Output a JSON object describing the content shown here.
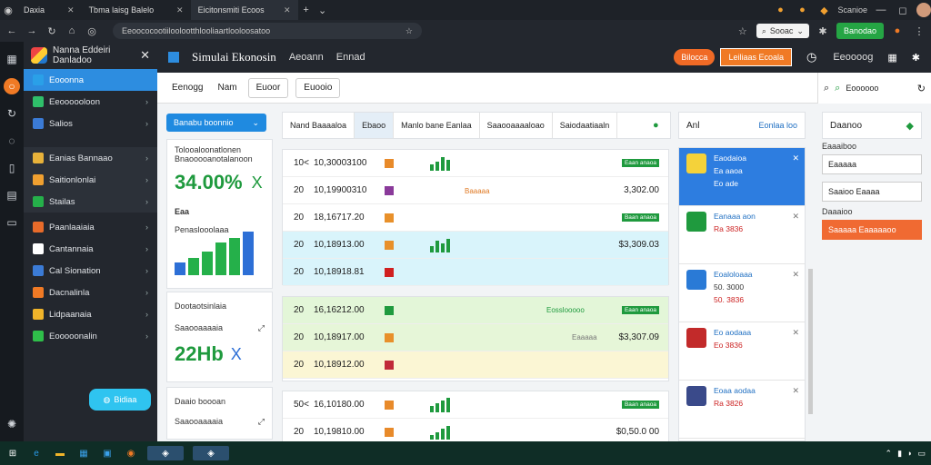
{
  "browser": {
    "tabs": [
      {
        "label": "Daxia",
        "active": false
      },
      {
        "label": "Tbma laisg Balelo",
        "active": false
      },
      {
        "label": "Eicitonsmiti Ecoos",
        "active": true
      }
    ],
    "url": "Eeoococootiiloolootthlooliaartlooloosatoo",
    "search_label": "Sooac",
    "ext_label": "Scanioe",
    "go_button": "Banodao"
  },
  "sidebar": {
    "title_line1": "Nanna Eddeiri",
    "title_line2": "Danladoo",
    "items": [
      {
        "label": "Eooonna",
        "icon": "#2aa0e8",
        "active": true,
        "sub": false
      },
      {
        "label": "Eeoooooloon",
        "icon": "#2fbf6a",
        "active": false,
        "sub": false
      },
      {
        "label": "Salios",
        "icon": "#3b7bd6",
        "active": false,
        "sub": false
      },
      {
        "label": "Eanias Bannaao",
        "icon": "#e8b23a",
        "active": false,
        "sub": true
      },
      {
        "label": "Saitionlonlai",
        "icon": "#f0a030",
        "active": false,
        "sub": true
      },
      {
        "label": "Stailas",
        "icon": "#25b04a",
        "active": false,
        "sub": true
      },
      {
        "label": "Paanlaaiaia",
        "icon": "#e86b2a",
        "active": false,
        "sub": false
      },
      {
        "label": "Cantannaia",
        "icon": "#ffffff",
        "active": false,
        "sub": false
      },
      {
        "label": "Cal Sionation",
        "icon": "#3b7bd6",
        "active": false,
        "sub": false
      },
      {
        "label": "Dacnalinla",
        "icon": "#f07a25",
        "active": false,
        "sub": false
      },
      {
        "label": "Lidpaanaia",
        "icon": "#f0b42a",
        "active": false,
        "sub": false
      },
      {
        "label": "Eooooonalin",
        "icon": "#2fbf4a",
        "active": false,
        "sub": false
      }
    ],
    "pill_label": "Bidiaa"
  },
  "header": {
    "title": "Simulai Ekonosin",
    "link1": "Aeoann",
    "link2": "Ennad",
    "pill": "Bilocca",
    "button": "Leiliaas Ecoala",
    "right_label": "Eeoooog"
  },
  "toolbar": {
    "plain1": "Eenogg",
    "plain2": "Nam",
    "btn1": "Euoor",
    "btn2": "Euooio"
  },
  "left_cards": {
    "button": "Banabu boonnio",
    "card1_line1": "Tolooaloonatlonen",
    "card1_line2": "Bnaooooanotalanoon",
    "card1_value": "34.00%",
    "card1_x": "X",
    "card1_small": "Eaa",
    "card1_chart_label": "Penaslooolaaa",
    "card1_bars": [
      0.3,
      0.4,
      0.55,
      0.75,
      0.85,
      1.0
    ],
    "card2_title": "Dootaotsinlaia",
    "card2_label": "Saaooaaaaia",
    "card2_value": "22Hb",
    "card2_x": "X",
    "card3_title": "Daaio boooan",
    "card3_label": "Saaooaaaaia"
  },
  "table": {
    "tabs": [
      "Nand Baaaaloa",
      "Ebaoo",
      "Manlo bane Eanlaa",
      "Saaooaaaaloao",
      "Saiodaatiaaln"
    ],
    "rows": [
      {
        "no": "10<",
        "val": "10,30003100",
        "sq": "#e88a2a",
        "tag": "Eaan anaoa",
        "amt": "",
        "bars": [
          0.4,
          0.6,
          0.9,
          0.7
        ]
      },
      {
        "no": "20",
        "val": "10,19900310",
        "sq": "#8a3a9a",
        "tag": "",
        "amt": "3,302.00",
        "bars": []
      },
      {
        "no": "20",
        "val": "18,16717.20",
        "sq": "#e8902a",
        "tag": "Baan anaoa",
        "amt": "",
        "bars": []
      },
      {
        "no": "20",
        "val": "10,18913.00",
        "sq": "#e8902a",
        "tag": "",
        "amt": "$3,309.03",
        "bars": [
          0.4,
          0.8,
          0.6,
          0.9
        ]
      },
      {
        "no": "20",
        "val": "10,18918.81",
        "sq": "#d02020",
        "tag": "",
        "amt": "",
        "bars": []
      },
      {
        "no": "20",
        "val": "16,16212.00",
        "sq": "#1f9a3e",
        "tag": "Eaan anaoa",
        "amt": "",
        "bars": []
      },
      {
        "no": "20",
        "val": "10,18917.00",
        "sq": "#e8902a",
        "tag": "",
        "amt": "$3,307.09",
        "bars": []
      },
      {
        "no": "20",
        "val": "10,18912.00",
        "sq": "#c02a3a",
        "tag": "",
        "amt": "",
        "bars": []
      },
      {
        "no": "50<",
        "val": "16,10180.00",
        "sq": "#e88a2a",
        "tag": "Baan anaoa",
        "amt": "",
        "bars": [
          0.4,
          0.6,
          0.8,
          1.0
        ]
      },
      {
        "no": "20",
        "val": "10,19810.00",
        "sq": "#e88a2a",
        "tag": "",
        "amt": "$0,50.0 00",
        "bars": [
          0.3,
          0.5,
          0.7,
          0.9
        ]
      }
    ],
    "text_mid1": "Baaaaa",
    "text_mid2": "Eosslooooo",
    "text_mid3": "Eaaaaa"
  },
  "feed": {
    "header_left": "Anl",
    "header_right": "Eonlaa loo",
    "items": [
      {
        "title": "Eaodaioa",
        "sub": "Ea aaoa",
        "ref": "Eo ade",
        "sel": true,
        "thumb": "#f4d23a"
      },
      {
        "title": "Eanaaa aon",
        "sub": "",
        "ref": "Ra 3836",
        "sel": false,
        "thumb": "#1f9a3e"
      },
      {
        "title": "Eoaloloaaa",
        "sub": "50. 3000",
        "ref": "50. 3836",
        "sel": false,
        "thumb": "#2a7ad6"
      },
      {
        "title": "Eo aodaaa",
        "sub": "",
        "ref": "Eo 3836",
        "sel": false,
        "thumb": "#c22a2a"
      },
      {
        "title": "Eoaa aodaa",
        "sub": "",
        "ref": "Ra 3826",
        "sel": false,
        "thumb": "#3a4a8a"
      }
    ]
  },
  "form": {
    "title": "Daanoo",
    "label1": "Eaaaiboo",
    "field1": "Eaaaaa",
    "field2": "Saaioo Eaaaa",
    "label2": "Daaaioo",
    "button": "Saaaaa Eaaaaaoo"
  },
  "search_panel": {
    "label": "Eoooooo"
  }
}
